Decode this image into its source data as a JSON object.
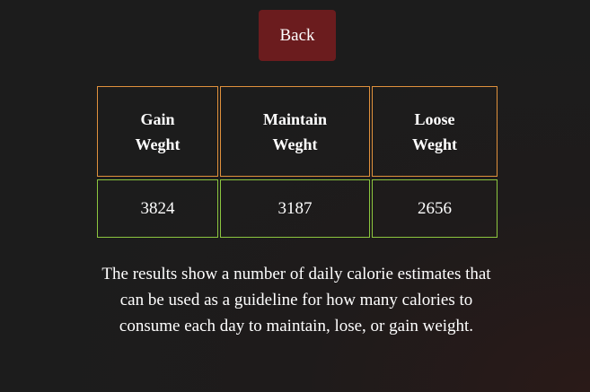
{
  "back_button": {
    "label": "Back"
  },
  "table": {
    "headers": [
      {
        "line1": "Gain",
        "line2": "Weght"
      },
      {
        "line1": "Maintain",
        "line2": "Weght"
      },
      {
        "line1": "Loose",
        "line2": "Weght"
      }
    ],
    "values": [
      "3824",
      "3187",
      "2656"
    ]
  },
  "description": "The results show a number of daily calorie estimates that can be used as a guideline for how many calories to consume each day to maintain, lose, or gain weight.",
  "colors": {
    "background": "#1c1c1c",
    "back_button": "#6b1c1e",
    "header_border": "#e0913c",
    "value_border": "#8cc63f",
    "text": "#ffffff"
  }
}
